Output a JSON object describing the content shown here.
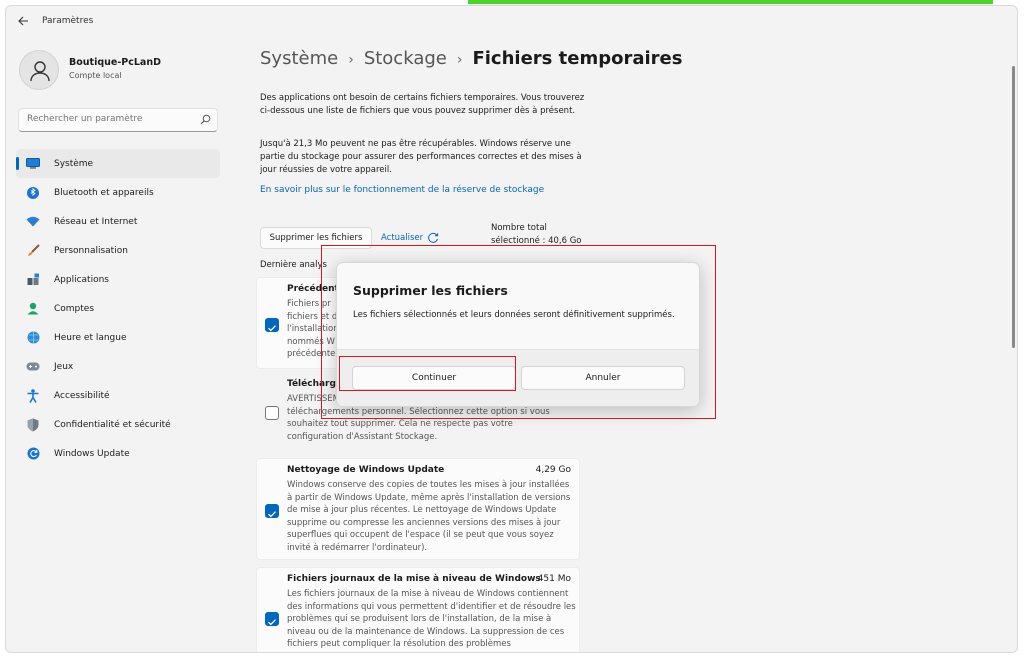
{
  "window": {
    "title": "Paramètres"
  },
  "profile": {
    "name": "Boutique-PcLanD",
    "account_type": "Compte local"
  },
  "search": {
    "placeholder": "Rechercher un paramètre"
  },
  "sidebar": {
    "items": [
      {
        "label": "Système",
        "icon": "monitor-icon",
        "active": true
      },
      {
        "label": "Bluetooth et appareils",
        "icon": "bluetooth-icon"
      },
      {
        "label": "Réseau et Internet",
        "icon": "wifi-icon"
      },
      {
        "label": "Personnalisation",
        "icon": "brush-icon"
      },
      {
        "label": "Applications",
        "icon": "apps-icon"
      },
      {
        "label": "Comptes",
        "icon": "person-icon"
      },
      {
        "label": "Heure et langue",
        "icon": "globe-clock-icon"
      },
      {
        "label": "Jeux",
        "icon": "gamepad-icon"
      },
      {
        "label": "Accessibilité",
        "icon": "accessibility-icon"
      },
      {
        "label": "Confidentialité et sécurité",
        "icon": "shield-icon"
      },
      {
        "label": "Windows Update",
        "icon": "update-icon"
      }
    ]
  },
  "breadcrumb": {
    "level1": "Système",
    "level2": "Stockage",
    "current": "Fichiers temporaires",
    "separator": "›"
  },
  "main": {
    "intro": "Des applications ont besoin de certains fichiers temporaires. Vous trouverez ci-dessous une liste de fichiers que vous pouvez supprimer dès à présent.",
    "reserve_note": "Jusqu'à 21,3 Mo peuvent ne pas être récupérables. Windows réserve une partie du stockage pour assurer des performances correctes et des mises à jour réussies de votre appareil.",
    "learn_more_link": "En savoir plus sur le fonctionnement de la réserve de stockage",
    "delete_button": "Supprimer les fichiers",
    "refresh_label": "Actualiser",
    "total_line1": "Nombre total",
    "total_line2": "sélectionné : 40,6 Go",
    "last_analysis": "Dernière analys"
  },
  "items": [
    {
      "title": "Précédent",
      "size": "",
      "checked": true,
      "desc": "Fichiers pr\nfichiers et d\nl'installation\nnommés W\nprécédente"
    },
    {
      "title": "Télécharge",
      "size": "",
      "checked": false,
      "desc": "AVERTISSEM\ntéléchargements personnel. Sélectionnez cette option si vous\nsouhaitez tout supprimer. Cela ne respecte pas votre\nconfiguration d'Assistant Stockage."
    },
    {
      "title": "Nettoyage de Windows Update",
      "size": "4,29 Go",
      "checked": true,
      "desc": "Windows conserve des copies de toutes les mises à jour installées à partir de Windows Update, même après l'installation de versions de mise à jour plus récentes. Le nettoyage de Windows Update supprime ou compresse les anciennes versions des mises à jour superflues qui occupent de l'espace (il se peut que vous soyez invité à redémarrer l'ordinateur)."
    },
    {
      "title": "Fichiers journaux de la mise à niveau de Windows",
      "size": "451 Mo",
      "checked": true,
      "desc": "Les fichiers journaux de la mise à niveau de Windows contiennent des informations qui vous permettent d'identifier et de résoudre les problèmes qui se produisent lors de l'installation, de la mise à niveau ou de la maintenance de Windows. La suppression de ces fichiers peut compliquer la résolution des problèmes"
    }
  ],
  "dialog": {
    "title": "Supprimer les fichiers",
    "message": "Les fichiers sélectionnés et leurs données seront définitivement supprimés.",
    "continue_label": "Continuer",
    "cancel_label": "Annuler"
  },
  "colors": {
    "accent": "#0067c0",
    "highlight": "#d6181e",
    "background": "#f3f3f3"
  }
}
